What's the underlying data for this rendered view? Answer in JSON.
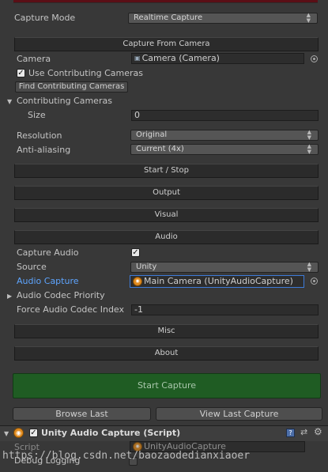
{
  "capture_mode": {
    "label": "Capture Mode",
    "value": "Realtime Capture"
  },
  "sections": {
    "capture_from_camera": "Capture From Camera",
    "start_stop": "Start / Stop",
    "output": "Output",
    "visual": "Visual",
    "audio": "Audio",
    "misc": "Misc",
    "about": "About"
  },
  "camera": {
    "label": "Camera",
    "value": "Camera (Camera)"
  },
  "use_contributing": {
    "label": "Use Contributing Cameras",
    "checked": true
  },
  "find_contributing_button": "Find Contributing Cameras",
  "contributing_cameras": {
    "label": "Contributing Cameras",
    "size_label": "Size",
    "size_value": "0"
  },
  "resolution": {
    "label": "Resolution",
    "value": "Original"
  },
  "anti_aliasing": {
    "label": "Anti-aliasing",
    "value": "Current (4x)"
  },
  "capture_audio": {
    "label": "Capture Audio",
    "checked": true
  },
  "source": {
    "label": "Source",
    "value": "Unity"
  },
  "audio_capture": {
    "label": "Audio Capture",
    "value": "Main Camera (UnityAudioCapture)"
  },
  "audio_codec_priority": {
    "label": "Audio Codec Priority"
  },
  "force_audio_codec_index": {
    "label": "Force Audio Codec Index",
    "value": "-1"
  },
  "start_capture_button": "Start Capture",
  "browse_last_button": "Browse Last",
  "view_last_capture_button": "View Last Capture",
  "script_component": {
    "title": "Unity Audio Capture (Script)",
    "script_label": "Script",
    "script_value": "UnityAudioCapture",
    "debug_logging_label": "Debug Logging"
  },
  "watermark": "https://blog.csdn.net/baozaodedianxiaoer",
  "colors": {
    "background": "#383838",
    "start_capture": "#1f5c23",
    "highlight_label": "#5ea5ff"
  }
}
